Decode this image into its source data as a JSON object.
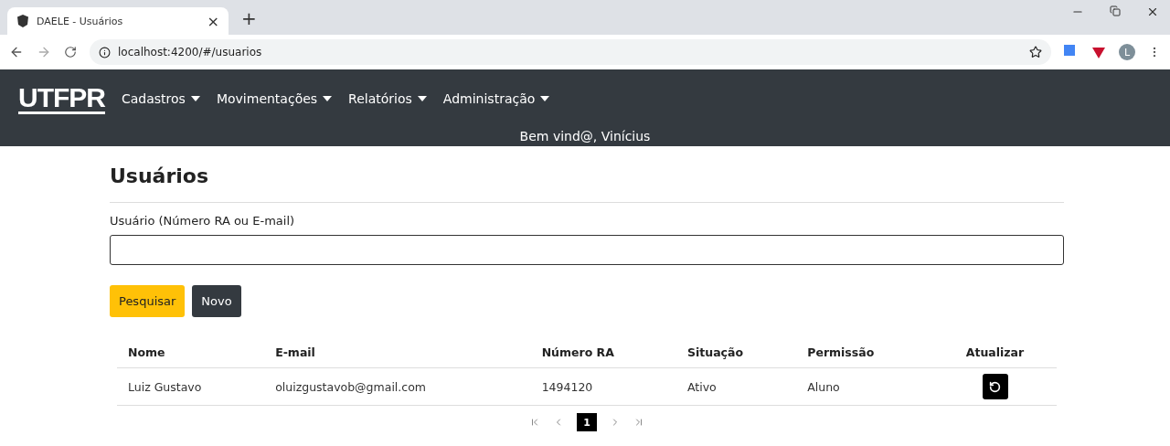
{
  "browser": {
    "tab": {
      "title": "DAELE - Usuários",
      "close": "×"
    },
    "new_tab": "+",
    "url": "localhost:4200/#/usuarios",
    "profile": "L"
  },
  "navbar": {
    "logo": "UTFPR",
    "menus": [
      {
        "label": "Cadastros"
      },
      {
        "label": "Movimentações"
      },
      {
        "label": "Relatórios"
      },
      {
        "label": "Administração"
      }
    ],
    "welcome": "Bem vind@, Vinícius"
  },
  "page": {
    "title": "Usuários",
    "search": {
      "label": "Usuário (Número RA ou E-mail)"
    },
    "buttons": [
      {
        "label": "Pesquisar",
        "kind": "primary"
      },
      {
        "label": "Novo",
        "kind": "dark"
      }
    ]
  },
  "table": {
    "columns": [
      "Nome",
      "E-mail",
      "Número RA",
      "Situação",
      "Permissão",
      "Atualizar"
    ],
    "rows": [
      {
        "cells": [
          "Luiz Gustavo",
          "oluizgustavob@gmail.com",
          "1494120",
          "Ativo",
          "Aluno"
        ]
      }
    ]
  },
  "pagination": {
    "pages": [
      {
        "label": "1",
        "selected": true
      }
    ]
  }
}
